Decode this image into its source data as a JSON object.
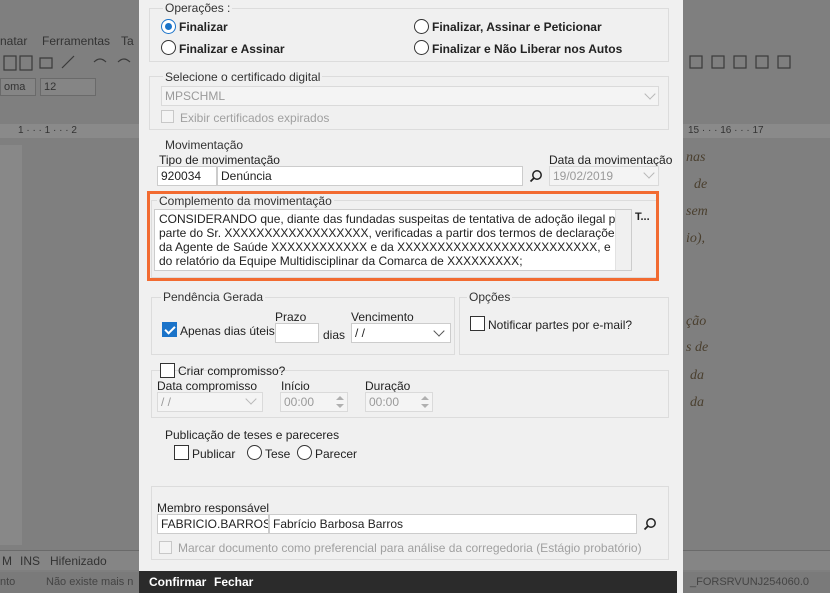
{
  "background": {
    "menu": [
      "natar",
      "Ferramentas",
      "Ta"
    ],
    "font_name": "oma",
    "font_size": "12",
    "ruler_left": "1 · · · 1 · · · 2",
    "ruler_right": "15 · · · 16 · · · 17",
    "doc_lines": [
      "nas",
      "de",
      "sem",
      "io),",
      "ção",
      "s de",
      "da",
      "da"
    ],
    "status_items": [
      "M",
      "INS",
      "Hifenizado"
    ],
    "bottom_left": "nto",
    "bottom_mid": "Não existe mais n",
    "bottom_right": "_FORSRVUNJ254060.0"
  },
  "operacoes": {
    "title": "Operações :",
    "opt_finalizar": "Finalizar",
    "opt_finalizar_assinar": "Finalizar e Assinar",
    "opt_finalizar_assinar_peticionar": "Finalizar, Assinar e Peticionar",
    "opt_finalizar_nao_liberar": "Finalizar e Não Liberar nos Autos"
  },
  "certificado": {
    "title": "Selecione o certificado digital",
    "selected": "MPSCHML",
    "expirados_label": "Exibir certificados expirados"
  },
  "movimentacao": {
    "title": "Movimentação",
    "tipo_label": "Tipo de movimentação",
    "tipo_code": "920034",
    "tipo_desc": "Denúncia",
    "data_label": "Data da movimentação",
    "data_value": "19/02/2019"
  },
  "complemento": {
    "title": "Complemento da movimentação",
    "text": "CONSIDERANDO que, diante das fundadas suspeitas de tentativa de adoção ilegal por parte do Sr. XXXXXXXXXXXXXXXXXX, verificadas a partir dos termos de declarações da Agente de Saúde XXXXXXXXXXXX e da XXXXXXXXXXXXXXXXXXXXXXXXX, e do relatório da Equipe Multidisciplinar da Comarca de XXXXXXXXX;",
    "side_button": "T..."
  },
  "pendencia": {
    "title": "Pendência Gerada",
    "apenas_dias_uteis": "Apenas dias úteis?",
    "prazo_label": "Prazo",
    "dias_label": "dias",
    "vencimento_label": "Vencimento",
    "vencimento_value": " /  /"
  },
  "opcoes": {
    "title": "Opções",
    "notificar": "Notificar partes por e-mail?"
  },
  "compromisso": {
    "criar_label": "Criar compromisso?",
    "data_label": "Data compromisso",
    "data_value": " /  /",
    "inicio_label": "Início",
    "inicio_value": "00:00",
    "duracao_label": "Duração",
    "duracao_value": "00:00"
  },
  "publicacao": {
    "title": "Publicação de teses e pareceres",
    "publicar": "Publicar",
    "tese": "Tese",
    "parecer": "Parecer"
  },
  "membro": {
    "title": "Membro responsável",
    "login": "FABRICIO.BARROS",
    "nome": "Fabrício Barbosa Barros",
    "preferencial": "Marcar documento como preferencial para análise da corregedoria (Estágio probatório)"
  },
  "footer": {
    "confirmar": "Confirmar",
    "fechar": "Fechar"
  },
  "colors": {
    "accent": "#1a73c9",
    "highlight": "#f26b31",
    "footer_bg": "#2b2b2b"
  }
}
